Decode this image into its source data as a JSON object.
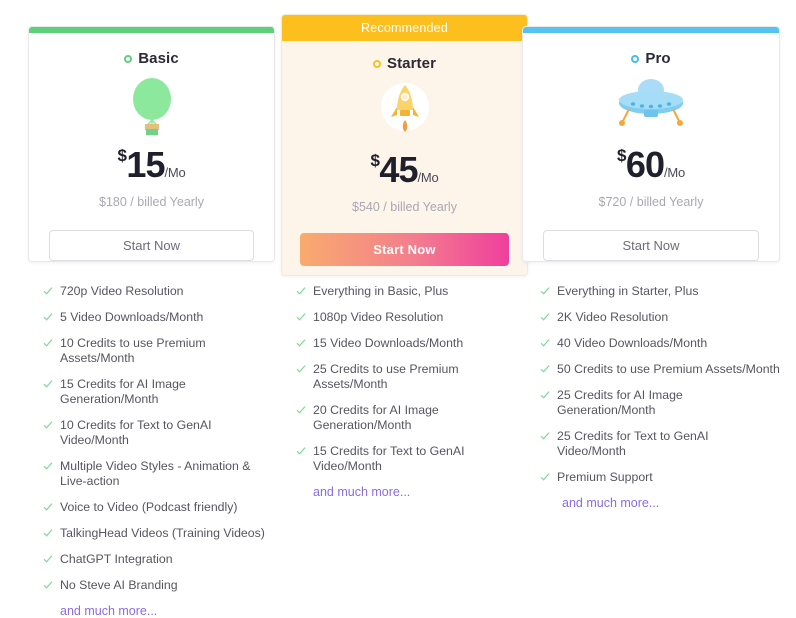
{
  "plans": [
    {
      "id": "basic",
      "name": "Basic",
      "badge": "",
      "currency": "$",
      "amount": "15",
      "per": "/Mo",
      "billed": "$180 / billed Yearly",
      "cta": "Start Now",
      "accent": "#5ed07a",
      "icon": "hot-air-balloon-icon",
      "features": [
        "720p Video Resolution",
        "5 Video Downloads/Month",
        "10 Credits to use Premium Assets/Month",
        "15 Credits for AI Image Generation/Month",
        "10 Credits for Text to GenAI Video/Month",
        "Multiple Video Styles - Animation & Live-action",
        "Voice to Video (Podcast friendly)",
        "TalkingHead Videos (Training Videos)",
        "ChatGPT Integration",
        "No Steve AI Branding"
      ],
      "more_link": "and much more..."
    },
    {
      "id": "starter",
      "name": "Starter",
      "badge": "Recommended",
      "currency": "$",
      "amount": "45",
      "per": "/Mo",
      "billed": "$540 / billed Yearly",
      "cta": "Start Now",
      "accent": "#fcbf1e",
      "icon": "rocket-icon",
      "features": [
        "Everything in Basic, Plus",
        "1080p Video Resolution",
        "15 Video Downloads/Month",
        "25 Credits to use Premium Assets/Month",
        "20 Credits for AI Image Generation/Month",
        "15 Credits for Text to GenAI Video/Month"
      ],
      "more_link": "and much more..."
    },
    {
      "id": "pro",
      "name": "Pro",
      "badge": "",
      "currency": "$",
      "amount": "60",
      "per": "/Mo",
      "billed": "$720 / billed Yearly",
      "cta": "Start Now",
      "accent": "#55c3f0",
      "icon": "ufo-icon",
      "features": [
        "Everything in Starter, Plus",
        "2K Video Resolution",
        "40 Video Downloads/Month",
        "50 Credits to use Premium Assets/Month",
        "25 Credits for AI Image Generation/Month",
        "25 Credits for Text to GenAI Video/Month",
        "Premium Support"
      ],
      "more_link": "and much more..."
    }
  ],
  "colors": {
    "check": "#7fd89a",
    "link": "#8b6ce0",
    "price": "#20202c",
    "muted": "#a8a8b3",
    "gradient_from": "#f9ab6d",
    "gradient_to": "#ef3f9c",
    "starter_bg": "#fdf5ea"
  }
}
